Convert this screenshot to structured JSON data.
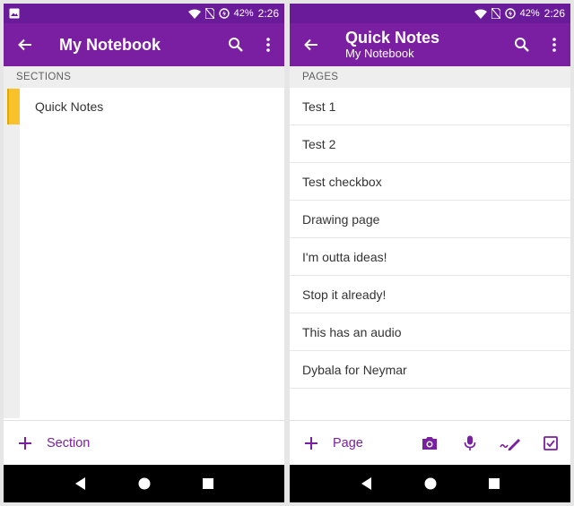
{
  "status_bar": {
    "battery": "42%",
    "time": "2:26"
  },
  "colors": {
    "primary": "#7b1fa2",
    "primary_dark": "#6a1b9a",
    "section_accent": "#f9c22b"
  },
  "left_screen": {
    "title": "My Notebook",
    "list_header": "SECTIONS",
    "sections": [
      {
        "label": "Quick Notes",
        "color": "#f9c22b"
      }
    ],
    "bottom_bar": {
      "add_label": "Section",
      "add_icon": "plus-icon"
    }
  },
  "right_screen": {
    "title": "Quick Notes",
    "subtitle": "My Notebook",
    "list_header": "PAGES",
    "pages": [
      "Test 1",
      "Test 2",
      "Test checkbox",
      "Drawing page",
      "I'm outta ideas!",
      "Stop it already!",
      "This has an audio",
      "Dybala for Neymar"
    ],
    "bottom_bar": {
      "add_label": "Page",
      "add_icon": "plus-icon",
      "tools": [
        "camera-icon",
        "microphone-icon",
        "pen-icon",
        "checkbox-icon"
      ]
    }
  }
}
